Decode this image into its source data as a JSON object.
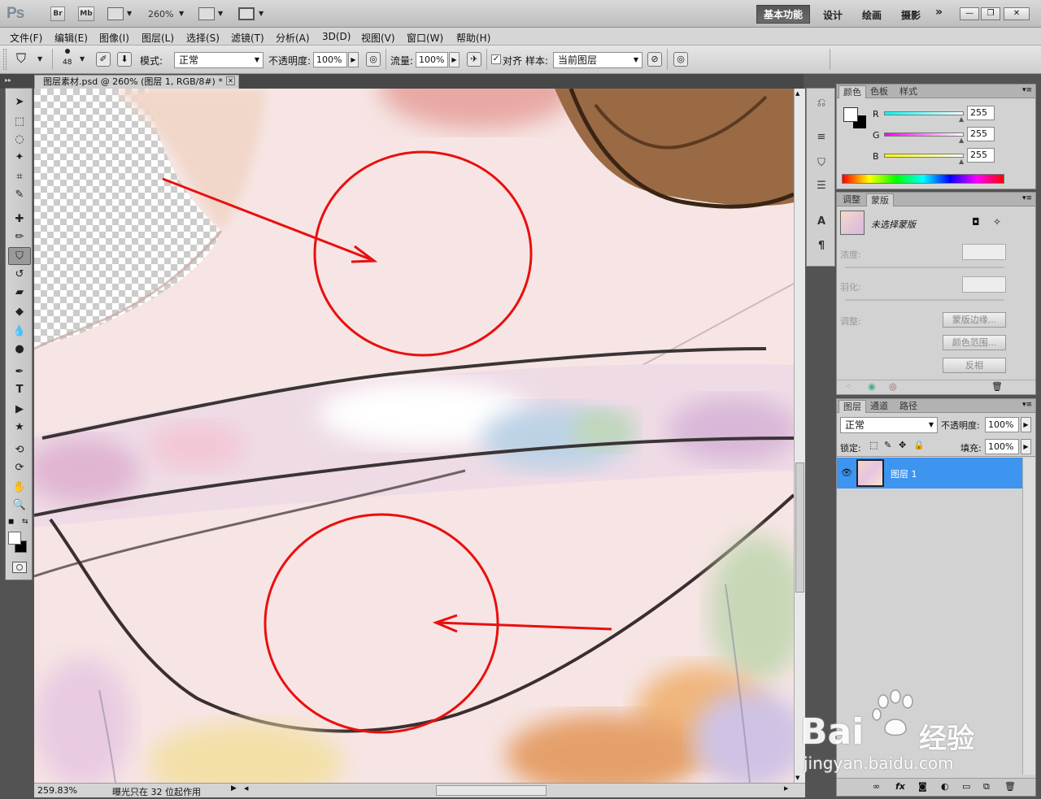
{
  "app": {
    "logo": "Ps",
    "br": "Br",
    "mb": "Mb",
    "zoom": "260%"
  },
  "workspaces": {
    "active": "基本功能",
    "items": [
      "设计",
      "绘画",
      "摄影"
    ],
    "more": "»"
  },
  "menu": [
    "文件(F)",
    "编辑(E)",
    "图像(I)",
    "图层(L)",
    "选择(S)",
    "滤镜(T)",
    "分析(A)",
    "3D(D)",
    "视图(V)",
    "窗口(W)",
    "帮助(H)"
  ],
  "options": {
    "brush_size": "48",
    "mode_label": "模式:",
    "mode_value": "正常",
    "opacity_label": "不透明度:",
    "opacity_value": "100%",
    "flow_label": "流量:",
    "flow_value": "100%",
    "align_label": "对齐",
    "align_checked": true,
    "sample_label": "样本:",
    "sample_value": "当前图层"
  },
  "document": {
    "tab_title": "图层素材.psd @ 260% (图层 1, RGB/8#) *",
    "close": "✕"
  },
  "status": {
    "zoom": "259.83%",
    "message": "曝光只在 32 位起作用"
  },
  "color_panel": {
    "tabs": [
      "颜色",
      "色板",
      "样式"
    ],
    "channels": [
      {
        "name": "R",
        "value": "255"
      },
      {
        "name": "G",
        "value": "255"
      },
      {
        "name": "B",
        "value": "255"
      }
    ]
  },
  "mask_panel": {
    "tabs": [
      "调整",
      "蒙版"
    ],
    "title": "未选择蒙版",
    "density_label": "浓度:",
    "feather_label": "羽化:",
    "refine_label": "调整:",
    "btn_mask_edge": "蒙版边缘...",
    "btn_color_range": "颜色范围...",
    "btn_invert": "反相"
  },
  "layers_panel": {
    "tabs": [
      "图层",
      "通道",
      "路径"
    ],
    "blend_mode": "正常",
    "opacity_label": "不透明度:",
    "opacity_value": "100%",
    "lock_label": "锁定:",
    "fill_label": "填充:",
    "fill_value": "100%",
    "layer_name": "图层 1"
  },
  "watermark": {
    "brand_left": "Bai",
    "brand_right": "经验",
    "url": "jingyan.baidu.com"
  },
  "colors": {
    "annotation_red": "#e8100f",
    "selected_layer": "#3d95f0",
    "skin": "#f6e6e6"
  }
}
